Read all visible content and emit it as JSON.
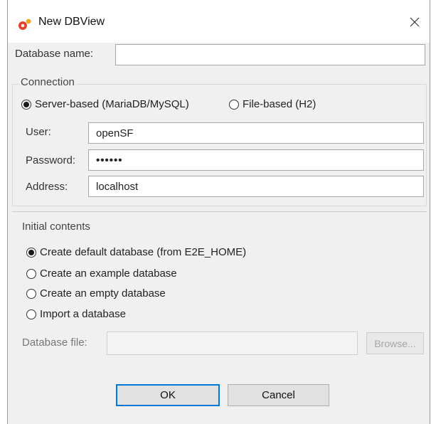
{
  "window": {
    "title": "New DBView",
    "app_icon": "openSF-app-icon",
    "close_icon": "close-icon"
  },
  "form": {
    "database_name": {
      "label": "Database name:",
      "value": ""
    },
    "connection": {
      "title": "Connection",
      "options": [
        "Server-based (MariaDB/MySQL)",
        "File-based (H2)"
      ],
      "selected": "Server-based (MariaDB/MySQL)",
      "user": {
        "label": "User:",
        "value": "openSF"
      },
      "password": {
        "label": "Password:",
        "value": "••••••"
      },
      "address": {
        "label": "Address:",
        "value": "localhost"
      }
    },
    "initial_contents": {
      "title": "Initial contents",
      "options": [
        "Create default database (from E2E_HOME)",
        "Create an example database",
        "Create an empty database",
        "Import a database"
      ],
      "selected": "Create default database (from E2E_HOME)",
      "database_file": {
        "label": "Database file:",
        "value": ""
      },
      "browse_label": "Browse..."
    }
  },
  "buttons": {
    "ok": "OK",
    "cancel": "Cancel"
  },
  "colors": {
    "default_button_border": "#0078d7",
    "dialog_bg": "#f0f0f0"
  }
}
